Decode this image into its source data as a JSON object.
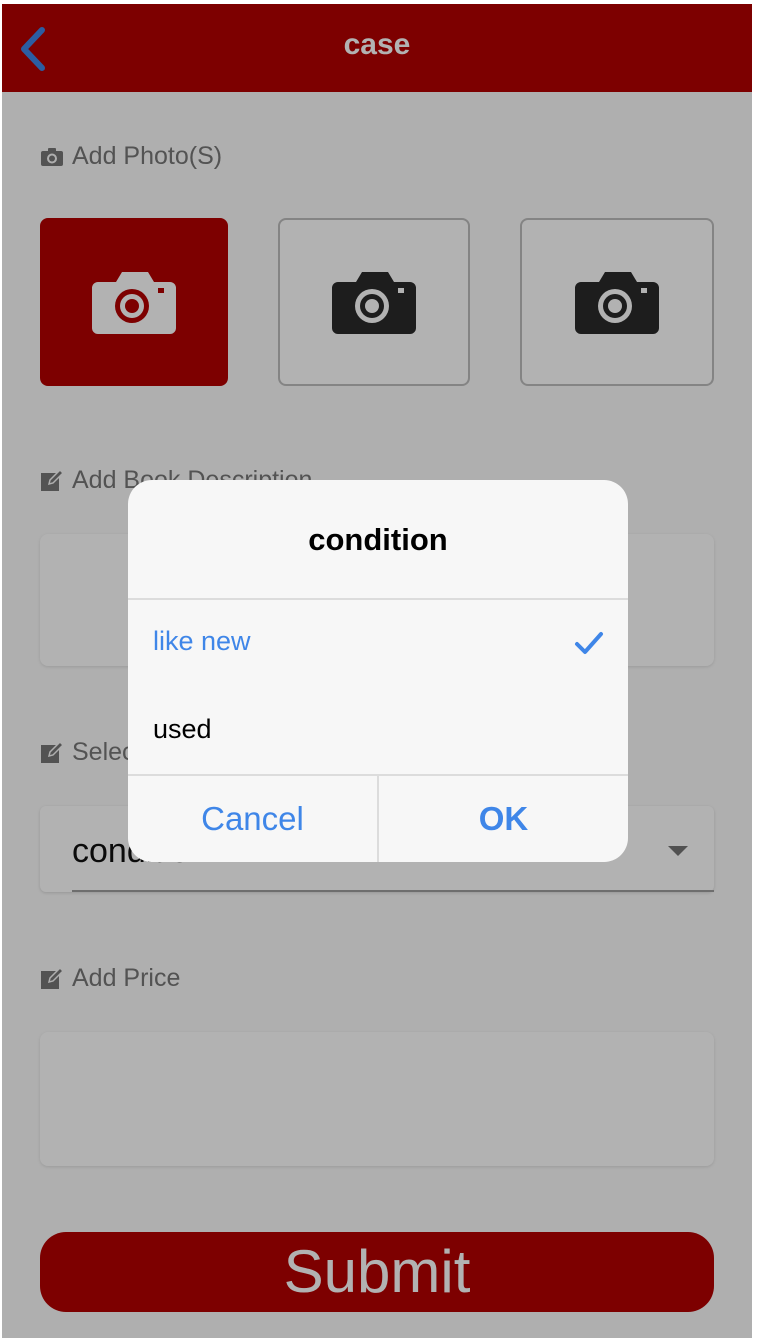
{
  "navbar": {
    "title": "case",
    "back_icon": "chevron-left-icon"
  },
  "photos": {
    "label": "Add Photo(S)",
    "label_icon": "camera-icon",
    "slots": [
      {
        "state": "active",
        "icon": "camera-icon"
      },
      {
        "state": "empty",
        "icon": "camera-icon"
      },
      {
        "state": "empty",
        "icon": "camera-icon"
      }
    ]
  },
  "description": {
    "label": "Add Book Description",
    "label_icon": "edit-icon",
    "value": ""
  },
  "condition_select": {
    "label": "Select Condition",
    "label_icon": "edit-icon",
    "value": "condition",
    "arrow_icon": "caret-down-icon"
  },
  "price": {
    "label": "Add Price",
    "label_icon": "edit-icon",
    "value": ""
  },
  "submit": {
    "label": "Submit"
  },
  "dialog": {
    "title": "condition",
    "options": [
      {
        "label": "like new",
        "selected": true
      },
      {
        "label": "used",
        "selected": false
      }
    ],
    "cancel_label": "Cancel",
    "ok_label": "OK",
    "check_icon": "checkmark-icon"
  },
  "colors": {
    "brand": "#b30000",
    "accent": "#3f86e8",
    "overlay": "rgba(0,0,0,0.3)"
  }
}
